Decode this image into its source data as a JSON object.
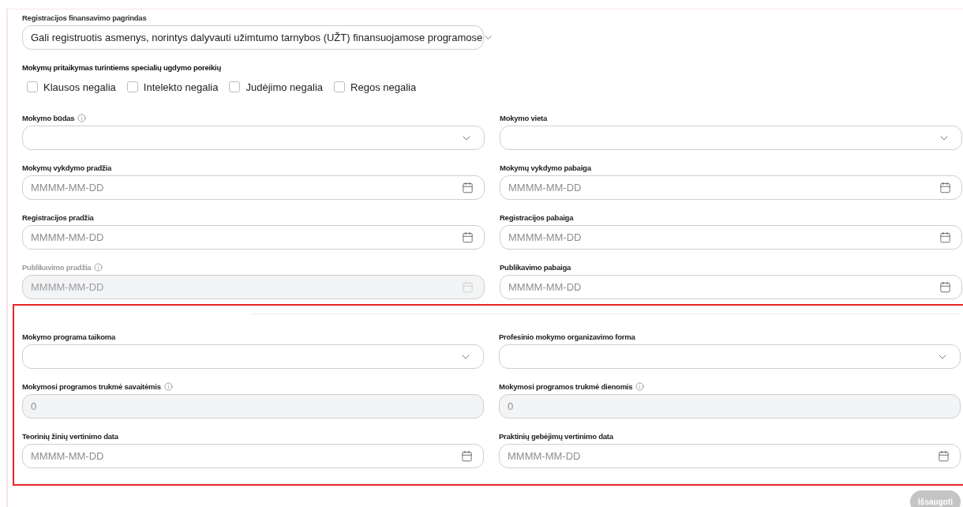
{
  "funding": {
    "label": "Registracijos finansavimo pagrindas",
    "value": "Gali registruotis asmenys, norintys dalyvauti užimtumo tarnybos (UŽT) finansuojamose programose"
  },
  "special_needs": {
    "label": "Mokymų pritaikymas turintiems specialių ugdymo poreikių",
    "options": [
      {
        "label": "Klausos negalia",
        "checked": false
      },
      {
        "label": "Intelekto negalia",
        "checked": false
      },
      {
        "label": "Judėjimo negalia",
        "checked": false
      },
      {
        "label": "Regos negalia",
        "checked": false
      }
    ]
  },
  "sections": [
    {
      "highlighted": false,
      "fields": [
        {
          "label": "Mokymo būdas",
          "kind": "select",
          "info": true,
          "disabled": false
        },
        {
          "label": "Mokymo vieta",
          "kind": "select",
          "info": false,
          "disabled": false
        },
        {
          "label": "Mokymų vykdymo pradžia",
          "kind": "date",
          "placeholder": "MMMM-MM-DD",
          "info": false,
          "disabled": false
        },
        {
          "label": "Mokymų vykdymo pabaiga",
          "kind": "date",
          "placeholder": "MMMM-MM-DD",
          "info": false,
          "disabled": false
        },
        {
          "label": "Registracijos pradžia",
          "kind": "date",
          "placeholder": "MMMM-MM-DD",
          "info": false,
          "disabled": false
        },
        {
          "label": "Registracijos pabaiga",
          "kind": "date",
          "placeholder": "MMMM-MM-DD",
          "info": false,
          "disabled": false
        },
        {
          "label": "Publikavimo pradžia",
          "kind": "date",
          "placeholder": "MMMM-MM-DD",
          "info": true,
          "disabled": true
        },
        {
          "label": "Publikavimo pabaiga",
          "kind": "date",
          "placeholder": "MMMM-MM-DD",
          "info": false,
          "disabled": false
        }
      ]
    },
    {
      "highlighted": true,
      "fields": [
        {
          "label": "Mokymo programa taikoma",
          "kind": "select",
          "info": false,
          "disabled": false
        },
        {
          "label": "Profesinio mokymo organizavimo forma",
          "kind": "select",
          "info": false,
          "disabled": false
        },
        {
          "label": "Mokymosi programos trukmė savaitėmis",
          "kind": "readonly",
          "placeholder": "0",
          "info": true,
          "disabled": false
        },
        {
          "label": "Mokymosi programos trukmė dienomis",
          "kind": "readonly",
          "placeholder": "0",
          "info": true,
          "disabled": false
        },
        {
          "label": "Teorinių žinių vertinimo data",
          "kind": "date",
          "placeholder": "MMMM-MM-DD",
          "info": false,
          "disabled": false
        },
        {
          "label": "Praktinių gebėjimų vertinimo data",
          "kind": "date",
          "placeholder": "MMMM-MM-DD",
          "info": false,
          "disabled": false
        }
      ]
    }
  ],
  "save_button": {
    "label": "Išsaugoti",
    "disabled": true
  }
}
